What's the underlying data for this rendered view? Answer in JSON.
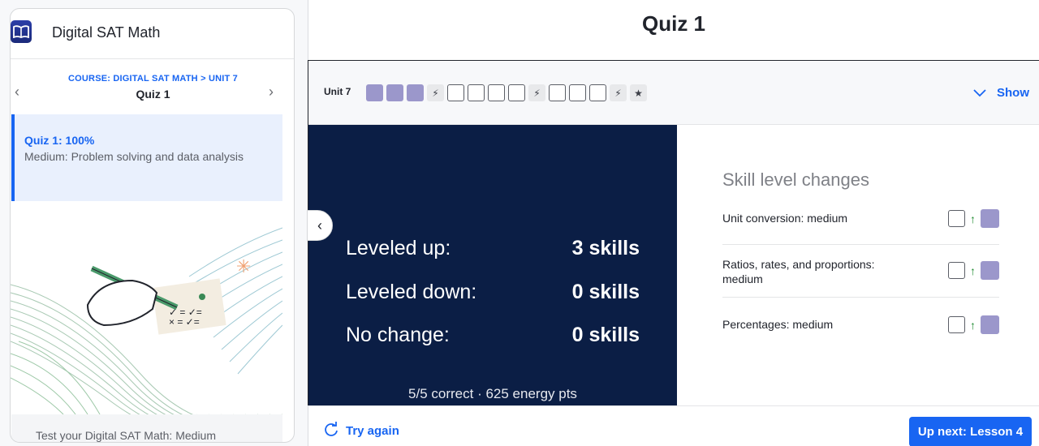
{
  "sidebar": {
    "title": "Digital SAT Math",
    "breadcrumb": "COURSE: DIGITAL SAT MATH > UNIT 7",
    "current": "Quiz 1",
    "active_item": {
      "title": "Quiz 1: 100%",
      "subtitle": "Medium: Problem solving and data analysis"
    },
    "footer_text": "Test your Digital SAT Math: Medium"
  },
  "main": {
    "title": "Quiz 1",
    "unit_label": "Unit 7",
    "show_label": "Show",
    "stats": [
      {
        "label": "Leveled up:",
        "value": "3 skills"
      },
      {
        "label": "Leveled down:",
        "value": "0 skills"
      },
      {
        "label": "No change:",
        "value": "0 skills"
      }
    ],
    "summary": "5/5 correct · 625 energy pts",
    "skills_heading": "Skill level changes",
    "skills": [
      {
        "name": "Unit conversion: medium"
      },
      {
        "name": "Ratios, rates, and proportions: medium"
      },
      {
        "name": "Percentages: medium"
      }
    ],
    "try_again": "Try again",
    "up_next": "Up next: Lesson 4"
  },
  "progress_boxes": [
    "filled",
    "filled",
    "filled",
    "lightning",
    "empty",
    "empty",
    "empty",
    "empty",
    "lightning",
    "empty",
    "empty",
    "empty",
    "lightning",
    "star"
  ],
  "colors": {
    "accent": "#1865f2",
    "dark_panel": "#0b1e45",
    "mastery_fill": "#9b97cb"
  }
}
